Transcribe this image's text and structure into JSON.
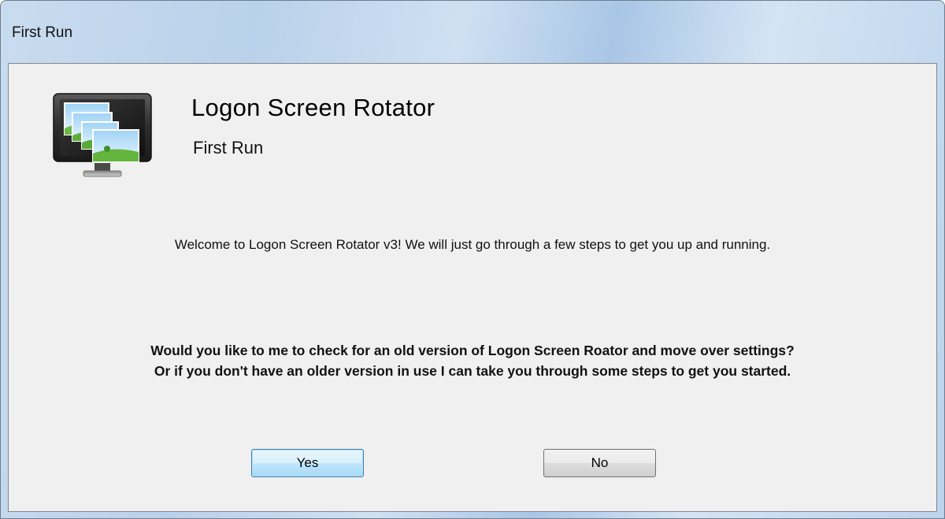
{
  "window": {
    "title": "First Run"
  },
  "header": {
    "app_name": "Logon Screen Rotator",
    "subtitle": "First Run",
    "icon": "monitor-with-pictures-icon"
  },
  "body": {
    "welcome": "Welcome to Logon Screen Rotator v3! We will just go through a few steps to get you up and running.",
    "question_line1": "Would you like to me to check for an old version of Logon Screen Roator and move over settings?",
    "question_line2": "Or if you don't have an older version in use I can take you through some steps to get you started."
  },
  "buttons": {
    "yes_label": "Yes",
    "no_label": "No"
  },
  "colors": {
    "frame_glass": "#b9d1ea",
    "client_bg": "#f0f0f0",
    "default_button_border": "#3c7fb1"
  }
}
